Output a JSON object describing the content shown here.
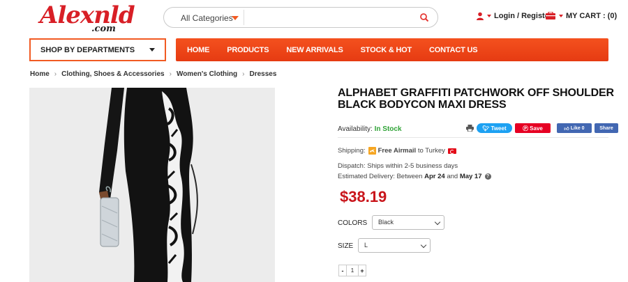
{
  "brand": {
    "logo_main": "Alexnld",
    "logo_sub": ".com"
  },
  "search": {
    "category": "All Categories",
    "placeholder": "",
    "value": ""
  },
  "account": {
    "login_label": "Login / Register",
    "cart_label": "MY CART : (0)"
  },
  "departments": {
    "label": "SHOP BY DEPARTMENTS"
  },
  "nav": {
    "items": [
      "HOME",
      "PRODUCTS",
      "NEW ARRIVALS",
      "STOCK & HOT",
      "CONTACT US"
    ]
  },
  "breadcrumb": [
    "Home",
    "Clothing, Shoes & Accessories",
    "Women's Clothing",
    "Dresses"
  ],
  "product": {
    "title": "ALPHABET GRAFFITI PATCHWORK OFF SHOULDER BLACK BODYCON MAXI DRESS",
    "availability_label": "Availability:",
    "availability_value": "In Stock",
    "shipping_prefix": "Shipping:",
    "shipping_method": "Free Airmail",
    "shipping_dest": "to Turkey",
    "dispatch": "Dispatch: Ships within 2-5 business days",
    "delivery_prefix": "Estimated Delivery: Between",
    "delivery_start": "Apr 24",
    "delivery_and": "and",
    "delivery_end": "May 17",
    "price": "$38.19",
    "colors_label": "COLORS",
    "color_selected": "Black",
    "size_label": "SIZE",
    "size_selected": "L",
    "quantity": "1",
    "qty_minus": "-",
    "qty_plus": "+"
  },
  "social": {
    "tweet": "Tweet",
    "save": "Save",
    "like": "Like 0",
    "share": "Share"
  },
  "colors": {
    "accent": "#f15a22",
    "brand_red": "#d81f26",
    "price_red": "#c9151b",
    "in_stock": "#2fa336"
  }
}
